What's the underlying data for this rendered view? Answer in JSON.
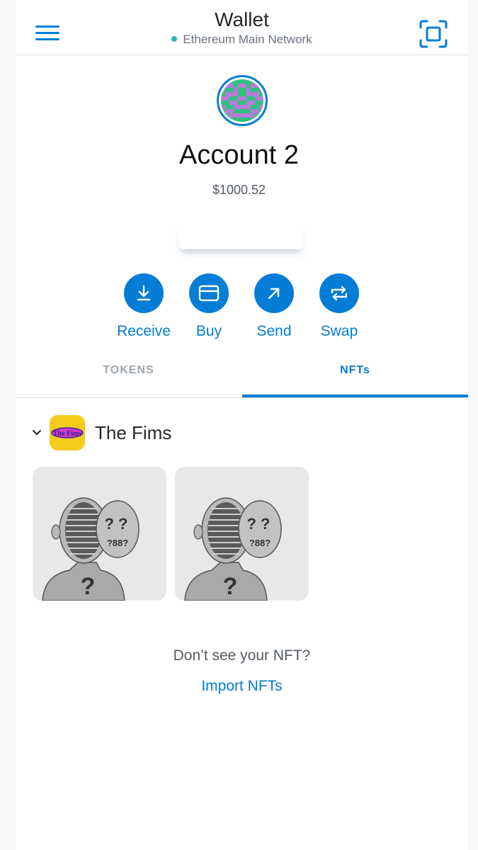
{
  "header": {
    "title": "Wallet",
    "network": "Ethereum Main Network"
  },
  "account": {
    "name": "Account 2",
    "balance": "$1000.52"
  },
  "actions": [
    {
      "label": "Receive",
      "icon": "download-icon"
    },
    {
      "label": "Buy",
      "icon": "card-icon"
    },
    {
      "label": "Send",
      "icon": "arrow-up-right-icon"
    },
    {
      "label": "Swap",
      "icon": "swap-arrows-icon"
    }
  ],
  "tabs": {
    "tokens": "TOKENS",
    "nfts": "NFTs",
    "active": "nfts"
  },
  "collection": {
    "name": "The Fims",
    "logo_text": "The Fims",
    "expanded": true,
    "items_count": 2
  },
  "footer": {
    "no_nft_text": "Don’t see your NFT?",
    "import_link": "Import NFTs"
  },
  "colors": {
    "accent": "#037dd6",
    "network_dot": "#29b6af",
    "collection_logo_bg": "#f5cc1a"
  }
}
